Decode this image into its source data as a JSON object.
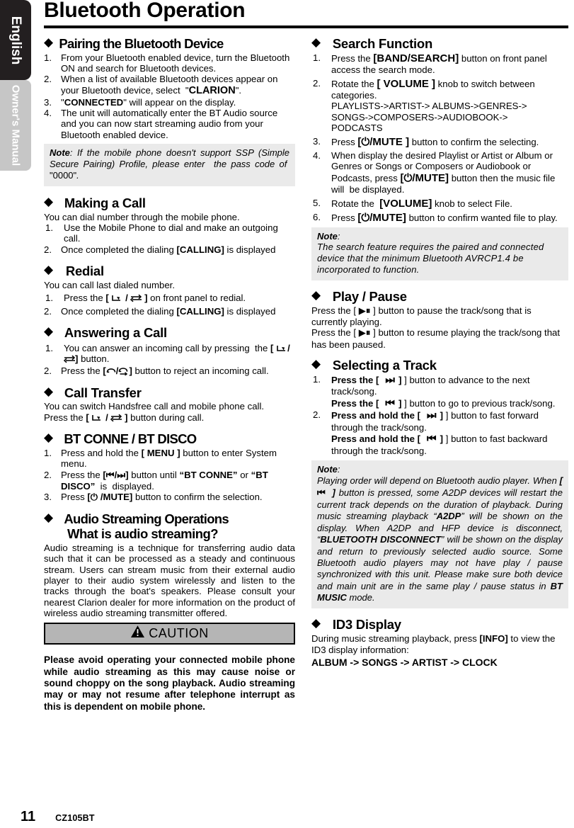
{
  "sidebar": {
    "language_tab": "English",
    "manual_tab": "Owner's Manual"
  },
  "header": {
    "title": "Bluetooth Operation"
  },
  "footer": {
    "page_number": "11",
    "model": "CZ105BT"
  },
  "left_column": {
    "pairing": {
      "heading": "Pairing the Bluetooth Device",
      "steps": [
        {
          "num": "1.",
          "text": "From your Bluetooth enabled device, turn the Bluetooth ON and search for Bluetooth devices."
        },
        {
          "num": "2.",
          "text": "When a list of available Bluetooth devices appear on your Bluetooth device, select  \"CLARION\"."
        },
        {
          "num": "3.",
          "text": "\"CONNECTED\" will appear on the display."
        },
        {
          "num": "4.",
          "text": "The unit will automatically enter the BT Audio source and you can now start streaming audio from your Bluetooth enabled device."
        }
      ],
      "note_label": "Note",
      "note_text": "If the mobile phone doesn't support SSP (Simple Secure Pairing) Profile, please enter  the pass code of  \"0000\"."
    },
    "making_call": {
      "heading": "Making a Call",
      "intro": "You can dial number through the mobile phone.",
      "steps": [
        {
          "num": "1.",
          "text": "Use the Mobile Phone to dial and make an outgoing call."
        },
        {
          "num": "2.",
          "text": "Once completed the dialing [CALLING] is displayed"
        }
      ]
    },
    "redial": {
      "heading": "Redial",
      "intro": "You can call last dialed number.",
      "steps": [
        {
          "num": "1.",
          "text": "Press the [ ✆ / ⇋ ] on front panel to redial."
        },
        {
          "num": "2.",
          "text": "Once completed the dialing [CALLING] is displayed"
        }
      ]
    },
    "answering": {
      "heading": "Answering a Call",
      "steps": [
        {
          "num": "1.",
          "text": "You can answer an incoming call by pressing the [ ✆/ ⇋] button."
        },
        {
          "num": "2.",
          "text": "Press the [✆/✇] button to reject an incoming call."
        }
      ]
    },
    "call_transfer": {
      "heading": "Call Transfer",
      "line1": "You can switch Handsfree call and mobile phone call.",
      "line2": "Press the [ ✆ / ⇋ ] button during call."
    },
    "bt_conne": {
      "heading": "BT CONNE / BT DISCO",
      "steps": [
        {
          "num": "1.",
          "text": "Press and hold the [ MENU ] button to enter System menu."
        },
        {
          "num": "2.",
          "text": "Press the [◄◄/►►] button until “BT CONNE” or “BT DISCO”  is  displayed."
        },
        {
          "num": "3.",
          "text": "Press [⏻ /MUTE] button to confirm the selection."
        }
      ]
    },
    "audio_streaming": {
      "heading_line1": "Audio Streaming Operations",
      "heading_line2": "What is audio streaming?",
      "body": "Audio streaming is a technique for transferring audio data such that it can be processed as a steady and continuous stream. Users can stream music from their external audio player to their audio system wirelessly and listen to the tracks through the boat's speakers. Please consult your nearest Clarion dealer for more information on the product of wireless audio streaming transmitter offered.",
      "caution_label": "CAUTION",
      "caution_icon": "warning-triangle-icon",
      "caution_body": "Please avoid operating your connected mobile phone while audio streaming as this may cause noise or sound choppy on the song  playback. Audio streaming may or may not resume after telephone interrupt as this is dependent on mobile phone."
    }
  },
  "right_column": {
    "search": {
      "heading": "Search Function",
      "steps": [
        {
          "num": "1.",
          "text": "Press the [BAND/SEARCH] button on front panel access the search mode."
        },
        {
          "num": "2.",
          "text": "Rotate the [ VOLUME ] knob to switch between categories."
        },
        {
          "num": "3.",
          "text": "Press [⏻/MUTE ] button to confirm the selecting."
        },
        {
          "num": "4.",
          "text": "When display the desired Playlist or Artist or Album or Genres or Songs or Composers or Audiobook or Podcasts, press [⏻/MUTE] button then the music file will  be displayed."
        },
        {
          "num": "5.",
          "text": "Rotate the  [VOLUME] knob to select File."
        },
        {
          "num": "6.",
          "text": "Press [⏻/MUTE] button to confirm wanted file to play."
        }
      ],
      "categories_line1": "PLAYLISTS->ARTIST-> ALBUMS->GENRES->",
      "categories_line2": "SONGS->COMPOSERS->AUDIOBOOK->",
      "categories_line3": "PODCASTS",
      "note_label": "Note",
      "note_text": "The search feature requires the paired and connected device that the minimum Bluetooth AVRCP1.4 be incorporated to function."
    },
    "play_pause": {
      "heading": "Play / Pause",
      "line1_a": "Press the [",
      "line1_b": "] button to pause the track/song that is currently playing.",
      "line2_a": "Press the [",
      "line2_b": "] button to resume playing the track/song that has been paused."
    },
    "selecting_track": {
      "heading": "Selecting a Track",
      "steps": [
        {
          "num": "1.",
          "line_a": "Press the [",
          "line_b": "] button to advance to the next track/song.",
          "line_c": "Press the [",
          "line_d": "] button to go to previous track/song."
        },
        {
          "num": "2.",
          "line_a": "Press and hold the [",
          "line_b": "] button to fast forward through the track/song.",
          "line_c": "Press and hold the [",
          "line_d": "] button to fast backward through the track/song."
        }
      ],
      "note_label": "Note",
      "note_text": "Playing order will depend on Bluetooth audio player. When [  ⏮  ] button is pressed, some A2DP devices will restart the current track depends on the duration of playback. During music streaming playback “A2DP” will be shown on the display. When A2DP and HFP device is disconnect, “BLUETOOTH DISCONNECT” will be shown on the display and return to previously selected audio source. Some Bluetooth audio players may not have play / pause synchronized with this unit. Please make sure both device and main unit are in the same play / pause status in BT MUSIC mode."
    },
    "id3": {
      "heading": "ID3 Display",
      "line1": "During music streaming playback, press [INFO] to view the ID3 display information:",
      "line2": "ALBUM -> SONGS -> ARTIST -> CLOCK"
    }
  },
  "colors": {
    "tab_dark": "#231f20",
    "tab_gray": "#c6c6c6",
    "note_bg": "#eaeaea",
    "caution_bg": "#b5b5b5"
  }
}
